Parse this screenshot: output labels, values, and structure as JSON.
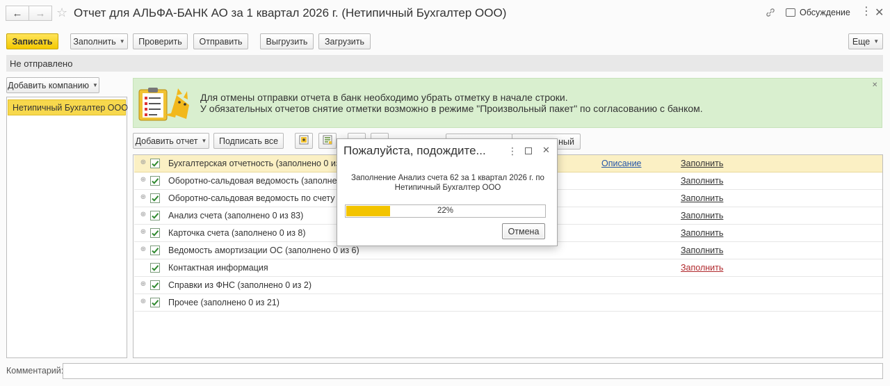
{
  "window": {
    "title": "Отчет для АЛЬФА-БАНК АО за 1 квартал 2026 г. (Нетипичный Бухгалтер ООО)",
    "discussion_label": "Обсуждение"
  },
  "toolbar": {
    "save_label": "Записать",
    "fill_label": "Заполнить",
    "check_label": "Проверить",
    "send_label": "Отправить",
    "export_label": "Выгрузить",
    "import_label": "Загрузить",
    "more_label": "Еще"
  },
  "status_text": "Не отправлено",
  "left_panel": {
    "add_company_label": "Добавить компанию",
    "companies": [
      "Нетипичный Бухгалтер ООО"
    ]
  },
  "info": {
    "line1": "Для отмены отправки отчета в банк необходимо убрать отметку в начале строки.",
    "line2": "У обязательных отчетов снятие отметки возможно в режиме \"Произвольный пакет\" по согласованию с банком."
  },
  "reports_toolbar": {
    "add_report_label": "Добавить отчет",
    "sign_all_label": "Подписать все",
    "right_button_label": "ный"
  },
  "reports": [
    {
      "label": "Бухгалтерская отчетность (заполнено 0 из 8)",
      "has_expander": true,
      "desc": "Описание",
      "action": "Заполнить",
      "action_red": false,
      "selected": true
    },
    {
      "label": "Оборотно-сальдовая ведомость (заполнено 0",
      "has_expander": true,
      "desc": "",
      "action": "Заполнить",
      "action_red": false,
      "selected": false
    },
    {
      "label": "Оборотно-сальдовая ведомость по счету (за",
      "has_expander": true,
      "desc": "",
      "action": "Заполнить",
      "action_red": false,
      "selected": false
    },
    {
      "label": "Анализ счета (заполнено 0 из 83)",
      "has_expander": true,
      "desc": "",
      "action": "Заполнить",
      "action_red": false,
      "selected": false
    },
    {
      "label": "Карточка счета (заполнено 0 из 8)",
      "has_expander": true,
      "desc": "",
      "action": "Заполнить",
      "action_red": false,
      "selected": false
    },
    {
      "label": "Ведомость амортизации ОС (заполнено 0 из 6)",
      "has_expander": true,
      "desc": "",
      "action": "Заполнить",
      "action_red": false,
      "selected": false
    },
    {
      "label": "Контактная информация",
      "has_expander": false,
      "desc": "",
      "action": "Заполнить",
      "action_red": true,
      "selected": false
    },
    {
      "label": "Справки из ФНС (заполнено 0 из 2)",
      "has_expander": true,
      "desc": "",
      "action": "",
      "action_red": false,
      "selected": false
    },
    {
      "label": "Прочее (заполнено 0 из 21)",
      "has_expander": true,
      "desc": "",
      "action": "",
      "action_red": false,
      "selected": false
    }
  ],
  "dialog": {
    "title": "Пожалуйста, подождите...",
    "message": "Заполнение Анализ счета 62 за 1 квартал 2026 г. по Нетипичный Бухгалтер ООО",
    "progress": 0.22,
    "progress_text": "22%",
    "cancel_label": "Отмена"
  },
  "comment_label": "Комментарий:",
  "colors": {
    "accent_yellow": "#f3c900",
    "info_bg": "#d9efcf",
    "selected_row": "#fbf0c4",
    "link_red": "#b0282c",
    "link_blue": "#2456a8"
  }
}
